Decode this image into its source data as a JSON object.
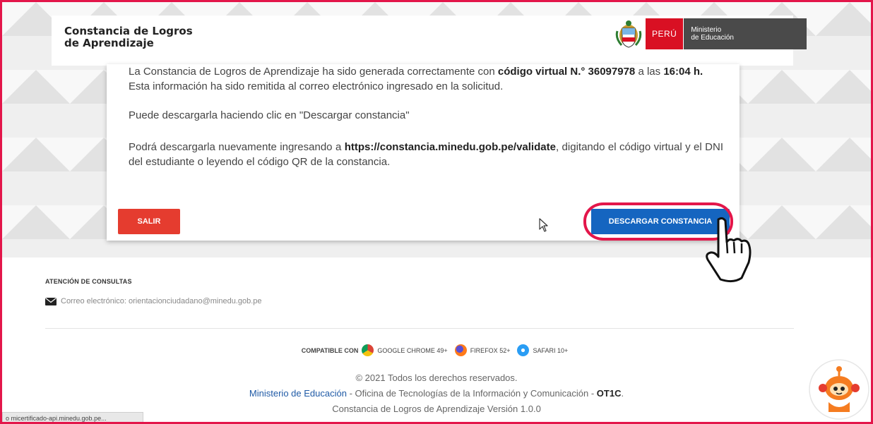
{
  "header": {
    "title_line1": "Constancia de Logros",
    "title_line2": "de Aprendizaje",
    "logo_country": "PERÚ",
    "logo_ministry_line1": "Ministerio",
    "logo_ministry_line2": "de Educación"
  },
  "card": {
    "p1_a": "La Constancia de Logros de Aprendizaje ha sido generada correctamente con ",
    "p1_b": "código virtual N.° 36097978",
    "p1_c": " a las ",
    "p1_d": "16:04 h.",
    "p1_e": " Esta información ha sido remitida al correo electrónico ingresado en la solicitud.",
    "p2": "Puede descargarla haciendo clic en \"Descargar constancia\"",
    "p3_a": "Podrá descargarla nuevamente ingresando a ",
    "p3_b": "https://constancia.minedu.gob.pe/validate",
    "p3_c": ", digitando el código virtual y el DNI del estudiante o leyendo el código QR de la constancia.",
    "salir_label": "SALIR",
    "descargar_label": "DESCARGAR CONSTANCIA"
  },
  "footer": {
    "title": "ATENCIÓN DE CONSULTAS",
    "email_text": "Correo electrónico: orientacionciudadano@minedu.gob.pe",
    "compat_label": "COMPATIBLE CON",
    "browsers": [
      "GOOGLE CHROME 49+",
      "FIREFOX 52+",
      "SAFARI 10+"
    ],
    "copyright": "© 2021 Todos los derechos reservados.",
    "ministry": "Ministerio de Educación",
    "office": " - Oficina de Tecnologías de la Información y Comunicación - ",
    "otic": "OT1C",
    "version": "Constancia de Logros de Aprendizaje Versión 1.0.0"
  },
  "status_bar": {
    "url": "o micertificado-api.minedu.gob.pe..."
  },
  "colors": {
    "accent_red": "#e53c2f",
    "primary_blue": "#1565c0",
    "highlight": "#e3164a",
    "peru_red": "#d91023"
  }
}
